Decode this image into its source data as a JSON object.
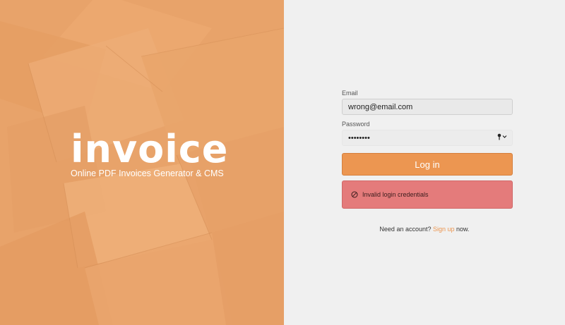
{
  "brand": {
    "logo_text": "invoice",
    "tagline": "Online PDF Invoices Generator & CMS"
  },
  "login": {
    "email_label": "Email",
    "email_value": "wrong@email.com",
    "password_label": "Password",
    "password_value": "••••••••",
    "submit_label": "Log in",
    "error_message": "Invalid login credentials",
    "signup_prefix": "Need an account?",
    "signup_link": "Sign up",
    "signup_suffix": "now."
  },
  "colors": {
    "left_panel": "#e9a56c",
    "accent": "#ec9651",
    "error": "#e47b7b"
  },
  "icons": {
    "password_manager": "key-icon",
    "error": "prohibited-icon"
  }
}
